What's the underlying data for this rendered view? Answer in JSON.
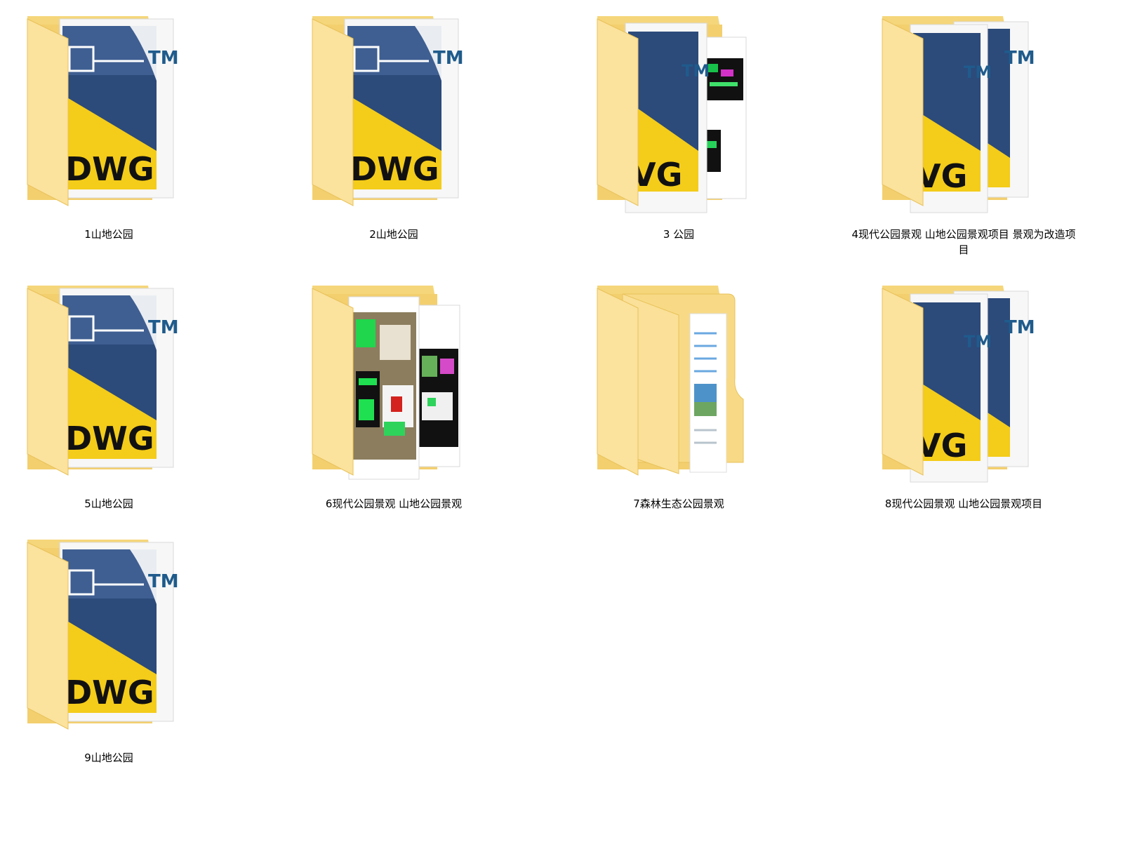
{
  "folders": [
    {
      "name": "1山地公园",
      "type": "dwg"
    },
    {
      "name": "2山地公园",
      "type": "dwg"
    },
    {
      "name": "3 公园",
      "type": "dwg-drawings"
    },
    {
      "name": "4现代公园景观 山地公园景观项目 景观为改造项目",
      "type": "dwg-double"
    },
    {
      "name": "5山地公园",
      "type": "dwg"
    },
    {
      "name": "6现代公园景观 山地公园景观",
      "type": "drawings"
    },
    {
      "name": "7森林生态公园景观",
      "type": "folder-docs"
    },
    {
      "name": "8现代公园景观 山地公园景观项目",
      "type": "dwg-double"
    },
    {
      "name": "9山地公园",
      "type": "dwg"
    }
  ],
  "icons": {
    "dwg_text": "DWG",
    "dwg_partial_text": "VG",
    "tm_text": "TM"
  },
  "colors": {
    "folder_back": "#f5d67a",
    "folder_front": "#fbe29d",
    "folder_edge": "#e8c25a",
    "dwg_blue": "#2c4a7a",
    "dwg_yellow": "#f4cc1a",
    "tm_blue": "#1f5b8c",
    "label_text": "#000000"
  }
}
